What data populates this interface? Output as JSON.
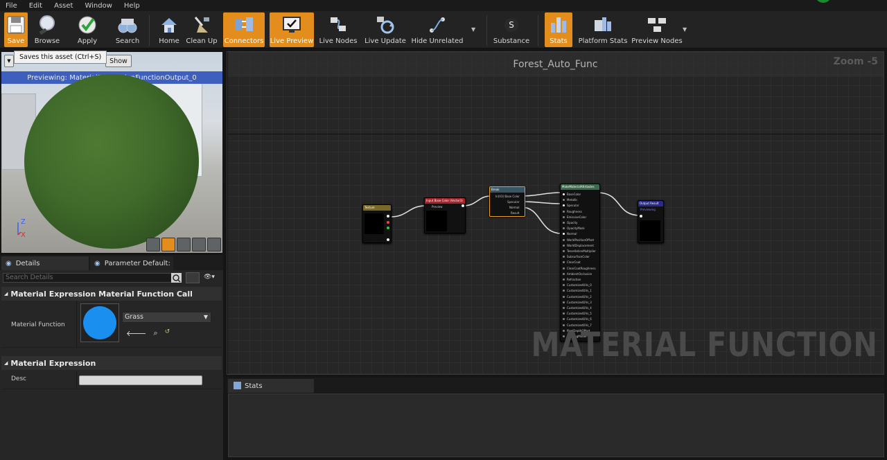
{
  "menu": [
    "File",
    "Edit",
    "Asset",
    "Window",
    "Help"
  ],
  "toolbar": {
    "save": "Save",
    "browse": "Browse",
    "apply": "Apply",
    "search": "Search",
    "home": "Home",
    "cleanup": "Clean Up",
    "connectors": "Connectors",
    "live_preview": "Live Preview",
    "live_nodes": "Live Nodes",
    "live_update": "Live Update",
    "hide_unrelated": "Hide Unrelated",
    "substance": "Substance",
    "stats": "Stats",
    "platform_stats": "Platform Stats",
    "preview_nodes": "Preview Nodes"
  },
  "tooltip": "Saves this asset (Ctrl+S)",
  "viewport": {
    "show_button": "Show",
    "previewing": "Previewing: MaterialExpressionFunctionOutput_0",
    "axis_z": "Z",
    "axis_x": "X"
  },
  "details": {
    "tab_details": "Details",
    "tab_params": "Parameter Default:",
    "search_placeholder": "Search Details",
    "section_call": "Material Expression Material Function Call",
    "material_function_label": "Material Function",
    "material_function_value": "Grass",
    "section_expr": "Material Expression",
    "desc_label": "Desc",
    "desc_value": ""
  },
  "graph": {
    "title": "Forest_Auto_Func",
    "zoom": "Zoom -5",
    "watermark": "MATERIAL FUNCTION",
    "nodes": {
      "n1": "Texture",
      "n2": "Input Base Color (Vector3)",
      "n2_pin": "Preview",
      "n3": "Break",
      "n3_pins": [
        "In(V3) Base Color",
        "Specular",
        "Normal",
        "Result"
      ],
      "n4": "MakeMaterialAttributes",
      "n4_pins": [
        "BaseColor",
        "Metallic",
        "Specular",
        "Roughness",
        "EmissiveColor",
        "Opacity",
        "OpacityMask",
        "Normal",
        "WorldPositionOffset",
        "WorldDisplacement",
        "TessellationMultiplier",
        "SubsurfaceColor",
        "ClearCoat",
        "ClearCoatRoughness",
        "AmbientOcclusion",
        "Refraction",
        "CustomizedUVs_0",
        "CustomizedUVs_1",
        "CustomizedUVs_2",
        "CustomizedUVs_3",
        "CustomizedUVs_4",
        "CustomizedUVs_5",
        "CustomizedUVs_6",
        "CustomizedUVs_7",
        "PixelDepthOffset",
        "ShadingModel"
      ],
      "n5": "Output Result",
      "n5_sub": "Previewing"
    }
  },
  "stats": {
    "tab": "Stats"
  },
  "colors": {
    "accent": "#e38d1d",
    "preview_bar": "#3e5fbe",
    "thumb_blue": "#1a8ff0"
  }
}
